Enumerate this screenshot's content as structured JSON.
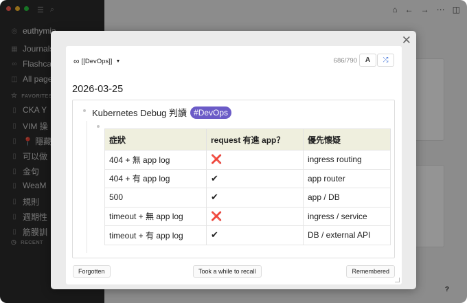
{
  "sidebar": {
    "graph_name": "euthymia",
    "nav": [
      {
        "label": "Journals",
        "icon": "calendar-icon"
      },
      {
        "label": "Flashcards",
        "icon": "infinity-icon"
      },
      {
        "label": "All pages",
        "icon": "pages-icon"
      }
    ],
    "favorites_label": "FAVORITES",
    "favorites": [
      "CKA Y",
      "VIM 操",
      "📍 隱藏",
      "可以做",
      "金句",
      "WeaM",
      "規則",
      "週期性",
      "筋膜訓"
    ],
    "recent_label": "RECENT"
  },
  "main": {
    "help_label": "?"
  },
  "modal": {
    "deck_label": "[[DevOps]]",
    "counter": "686/790",
    "a_button": "A",
    "date": "2026-03-25",
    "block_title": "Kubernetes Debug 判讀",
    "tag": "#DevOps",
    "table": {
      "headers": [
        "症狀",
        "request 有進 app？",
        "優先懷疑"
      ],
      "rows": [
        {
          "symptom": "404 + 無 app log",
          "mark": "❌",
          "suspect": "ingress routing"
        },
        {
          "symptom": "404 + 有 app log",
          "mark": "✔",
          "suspect": "app router"
        },
        {
          "symptom": "500",
          "mark": "✔",
          "suspect": "app / DB"
        },
        {
          "symptom": "timeout + 無 app log",
          "mark": "❌",
          "suspect": "ingress / service"
        },
        {
          "symptom": "timeout + 有 app log",
          "mark": "✔",
          "suspect": "DB / external API"
        }
      ]
    },
    "buttons": {
      "forgotten": "Forgotten",
      "recall": "Took a while to recall",
      "remembered": "Remembered"
    }
  }
}
